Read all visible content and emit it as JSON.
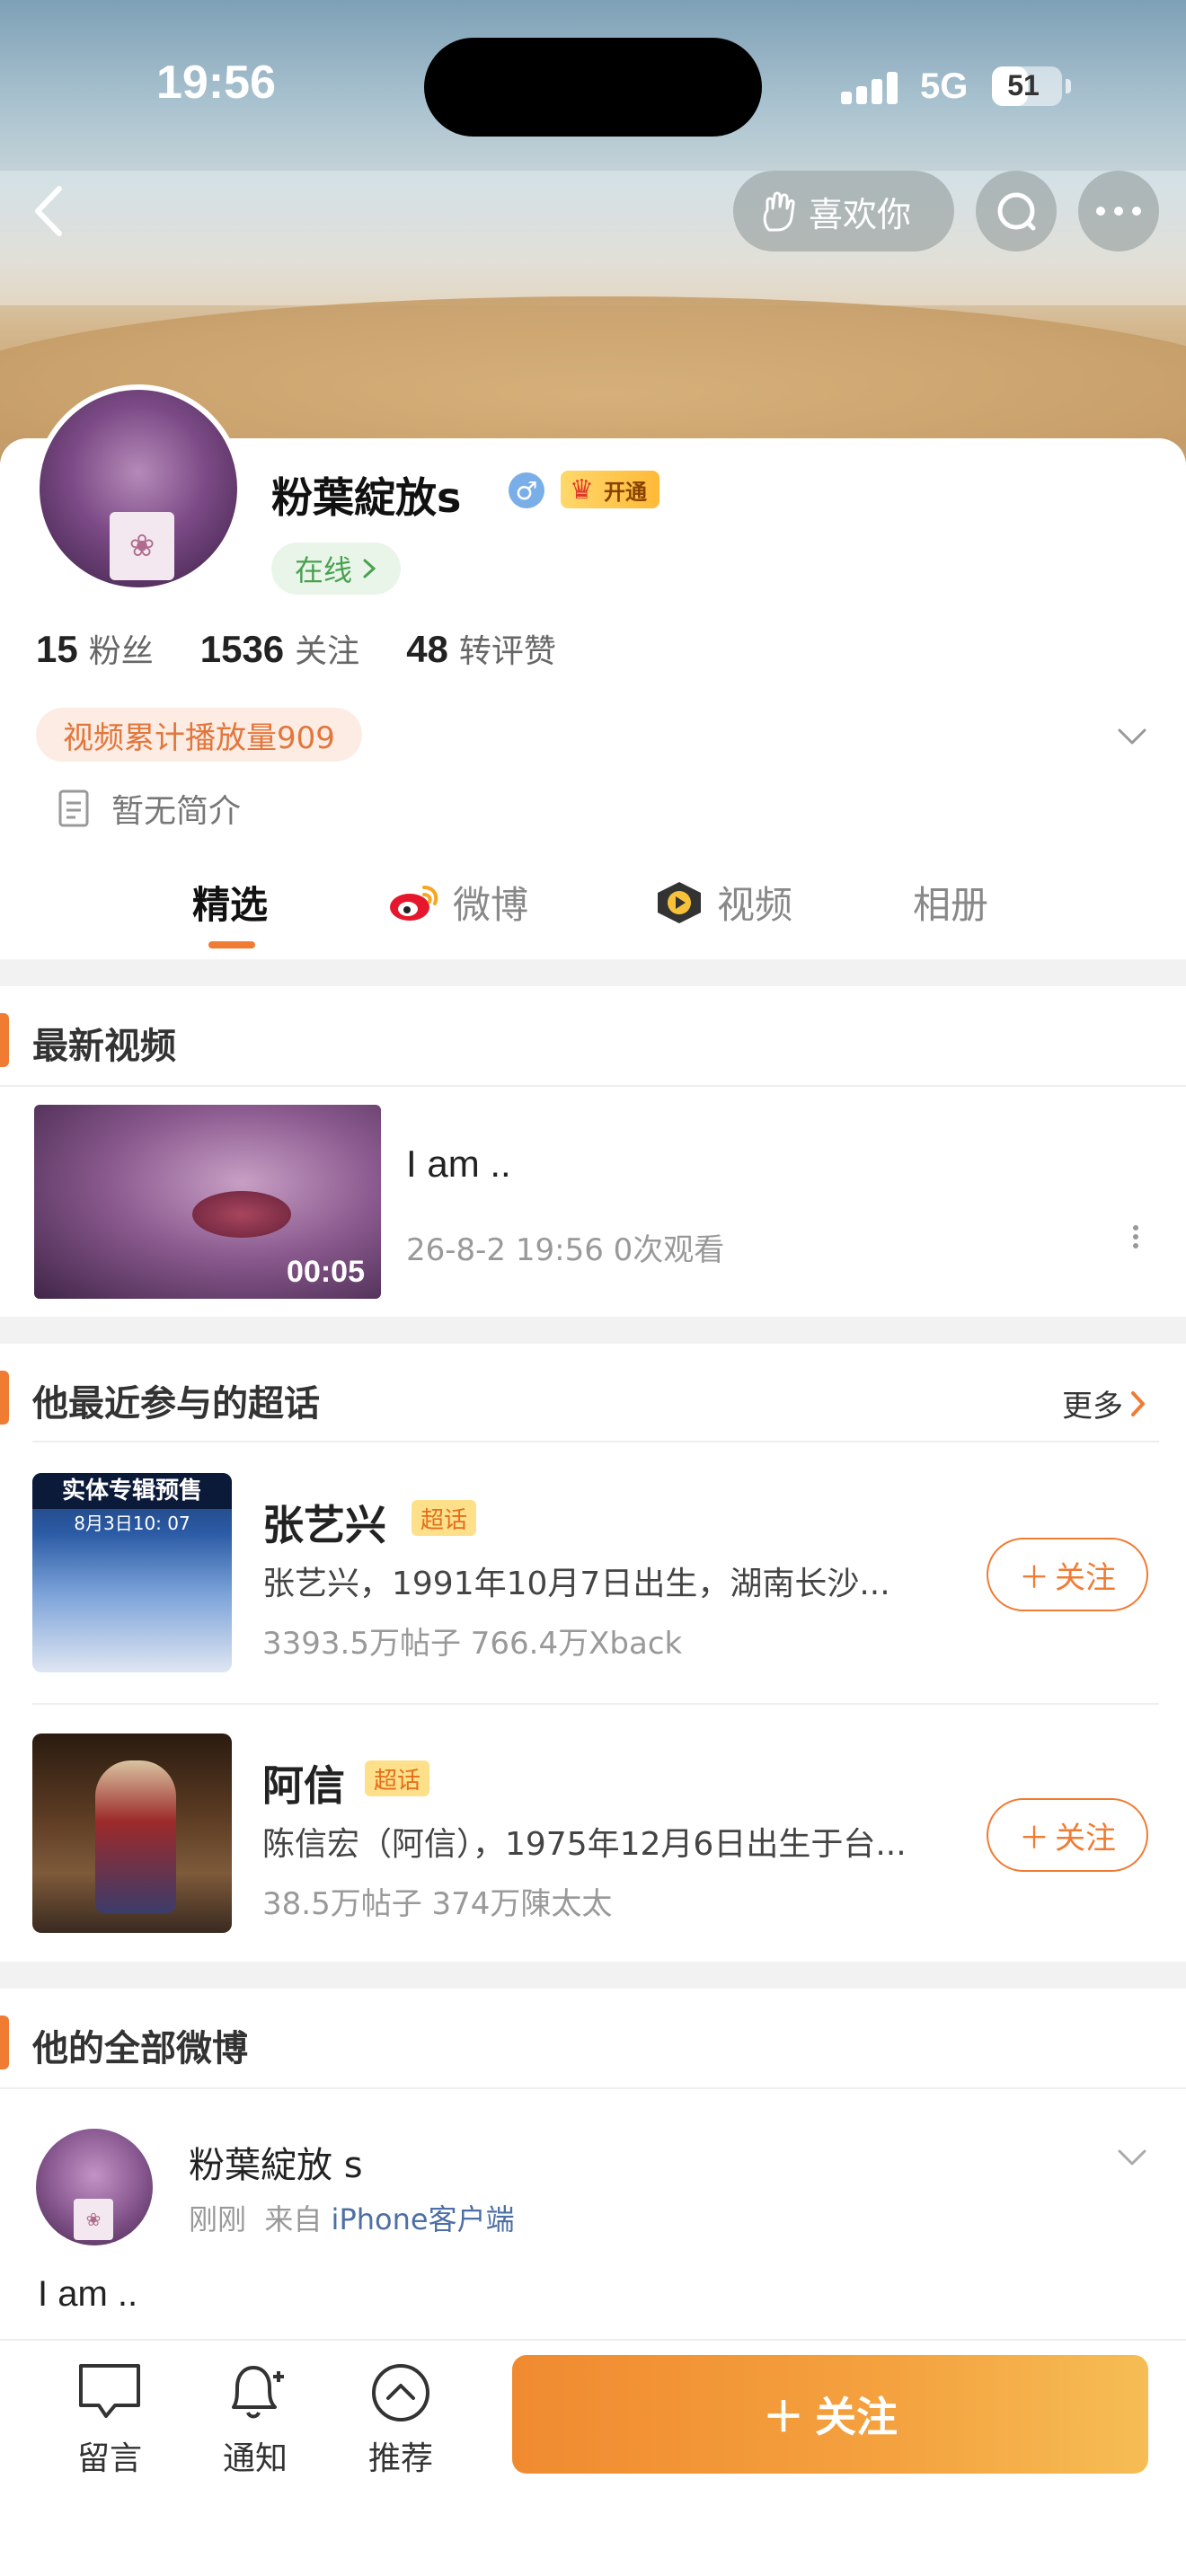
{
  "status_bar": {
    "time": "19:56",
    "network": "5G",
    "battery": "51",
    "battery_level": 0.51
  },
  "top_nav": {
    "like_label": "喜欢你"
  },
  "profile": {
    "name": "粉葉綻放s",
    "gender_symbol": "♂",
    "vip_label": "开通",
    "online_label": "在线",
    "stats": [
      {
        "count": "15",
        "label": "粉丝"
      },
      {
        "count": "1536",
        "label": "关注"
      },
      {
        "count": "48",
        "label": "转评赞"
      }
    ],
    "play_count_tag": "视频累计播放量909",
    "intro": "暂无简介"
  },
  "tabs": [
    {
      "label": "精选",
      "icon": ""
    },
    {
      "label": "微博",
      "icon": "weibo-icon"
    },
    {
      "label": "视频",
      "icon": "video-channel-icon"
    },
    {
      "label": "相册",
      "icon": ""
    }
  ],
  "latest_videos": {
    "title": "最新视频",
    "items": [
      {
        "title": "I am ..",
        "duration": "00:05",
        "meta": "26-8-2 19:56 0次观看"
      }
    ]
  },
  "super_topics": {
    "title": "他最近参与的超话",
    "more": "更多",
    "items": [
      {
        "name": "张艺兴",
        "tag": "超话",
        "desc": "张艺兴，1991年10月7日出生，湖南长沙...",
        "stats": "3393.5万帖子 766.4万Xback",
        "follow": "关注",
        "image_banner": "实体专辑预售",
        "image_date": "8月3日10: 07"
      },
      {
        "name": "阿信",
        "tag": "超话",
        "desc": "陈信宏（阿信），1975年12月6日出生于台...",
        "stats": "38.5万帖子 374万陳太太",
        "follow": "关注"
      }
    ]
  },
  "all_posts": {
    "title": "他的全部微博",
    "post": {
      "author": "粉葉綻放 s",
      "time": "刚刚",
      "source_prefix": "来自",
      "source": "iPhone客户端",
      "text": "I am .."
    }
  },
  "bottom_bar": {
    "items": [
      {
        "label": "留言",
        "icon": "comment-icon"
      },
      {
        "label": "通知",
        "icon": "bell-plus-icon"
      },
      {
        "label": "推荐",
        "icon": "recommend-icon"
      }
    ],
    "follow_label": "关注"
  },
  "colors": {
    "accent": "#f07b33",
    "online_green": "#4aa150",
    "link_blue": "#4e6fa6"
  }
}
